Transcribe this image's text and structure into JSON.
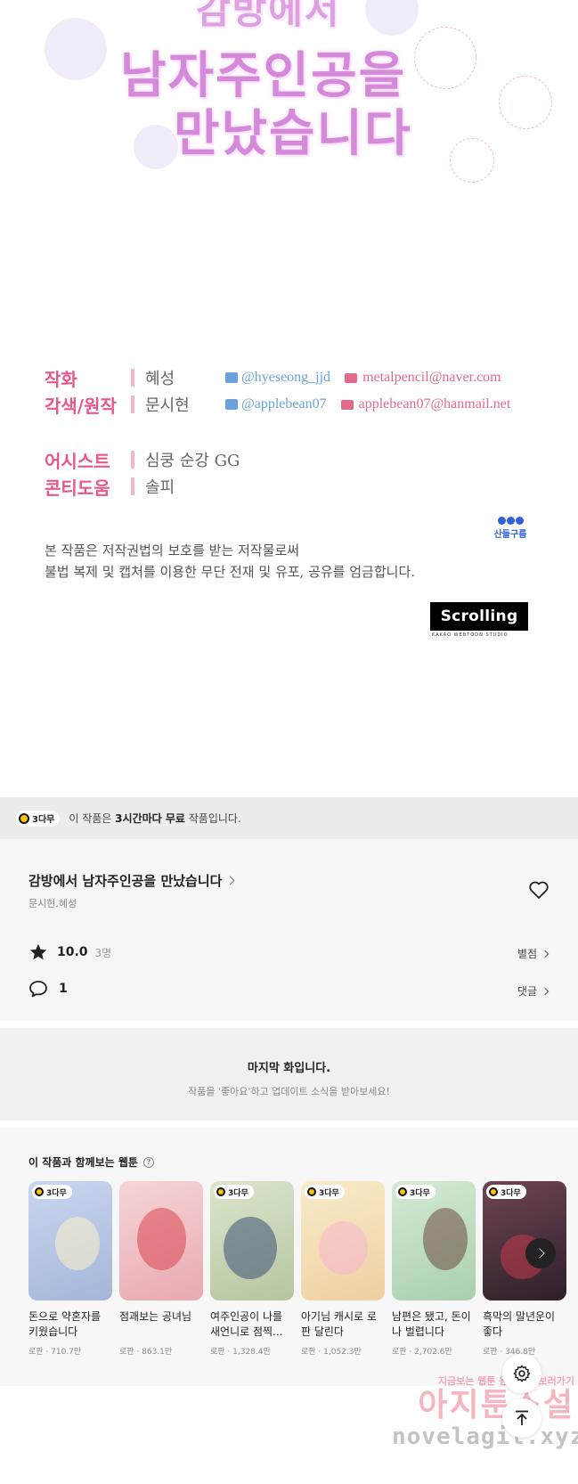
{
  "comic": {
    "title_top": "감방에서",
    "title_mid": "남자주인공을",
    "title_bot": "만났습니다",
    "credits": [
      {
        "label": "작화",
        "name": "혜성",
        "social": "@hyeseong_jjd",
        "mail": "metalpencil@naver.com"
      },
      {
        "label": "각색/원작",
        "name": "문시현",
        "social": "@applebean07",
        "mail": "applebean07@hanmail.net"
      },
      {
        "label": "어시스트",
        "name": "심쿵 순강 GG"
      },
      {
        "label": "콘티도움",
        "name": "솔피"
      }
    ],
    "studio_badge": "산들구름",
    "notice_line1": "본 작품은 저작권법의 보호를 받는 저작물로써",
    "notice_line2": "불법 복제 및 캡처를 이용한 무단 전재 및 유포, 공유를 엄금합니다.",
    "scroll_logo": "Scrolling",
    "scroll_sub": "KAKAO WEBTOON STUDIO"
  },
  "free_bar": {
    "badge": "3다무",
    "text_pre": "이 작품은 ",
    "text_bold": "3시간마다 무료",
    "text_post": " 작품입니다."
  },
  "info": {
    "title": "감방에서 남자주인공을 만났습니다",
    "authors": "문시현,혜성",
    "rating": "10.0",
    "rating_count": "3명",
    "rating_link": "별점",
    "comment_count": "1",
    "comment_link": "댓글"
  },
  "last": {
    "title": "마지막 화입니다.",
    "subtitle": "작품을 '좋아요'하고 업데이트 소식을 받아보세요!"
  },
  "recs": {
    "title": "이 작품과 함께보는 웹툰",
    "items": [
      {
        "badge": "3다무",
        "name": "돈으로 약혼자를 키웠습니다",
        "meta": "로판 · 710.7만"
      },
      {
        "badge": "",
        "name": "점괘보는 공녀님",
        "meta": "로판 · 863.1만"
      },
      {
        "badge": "3다무",
        "name": "여주인공이 나를 새언니로 점찍...",
        "meta": "로판 · 1,328.4만"
      },
      {
        "badge": "3다무",
        "name": "아기님 캐시로 로판 달린다",
        "meta": "로판 · 1,052.3만"
      },
      {
        "badge": "3다무",
        "name": "남편은 됐고, 돈이나 벌렵니다",
        "meta": "로판 · 2,702.6만"
      },
      {
        "badge": "3다무",
        "name": "흑막의 말년운이 좋다",
        "meta": "로판 · 346.8만"
      }
    ],
    "thumb_colors": [
      "#b9c8e6",
      "#f2c2c6",
      "#c9d7b8",
      "#f5e2b8",
      "#c6e0c9",
      "#5a3b47"
    ]
  },
  "watermark": {
    "top": "지금보는 웹툰 원작소설 보러가기",
    "mid": "아지툰소설",
    "bot": "novelagit.xyz"
  },
  "icons": {
    "heart": "heart-icon",
    "star": "star-icon",
    "comment": "comment-icon",
    "settings": "gear-icon",
    "scroll_top": "arrow-up-icon"
  }
}
